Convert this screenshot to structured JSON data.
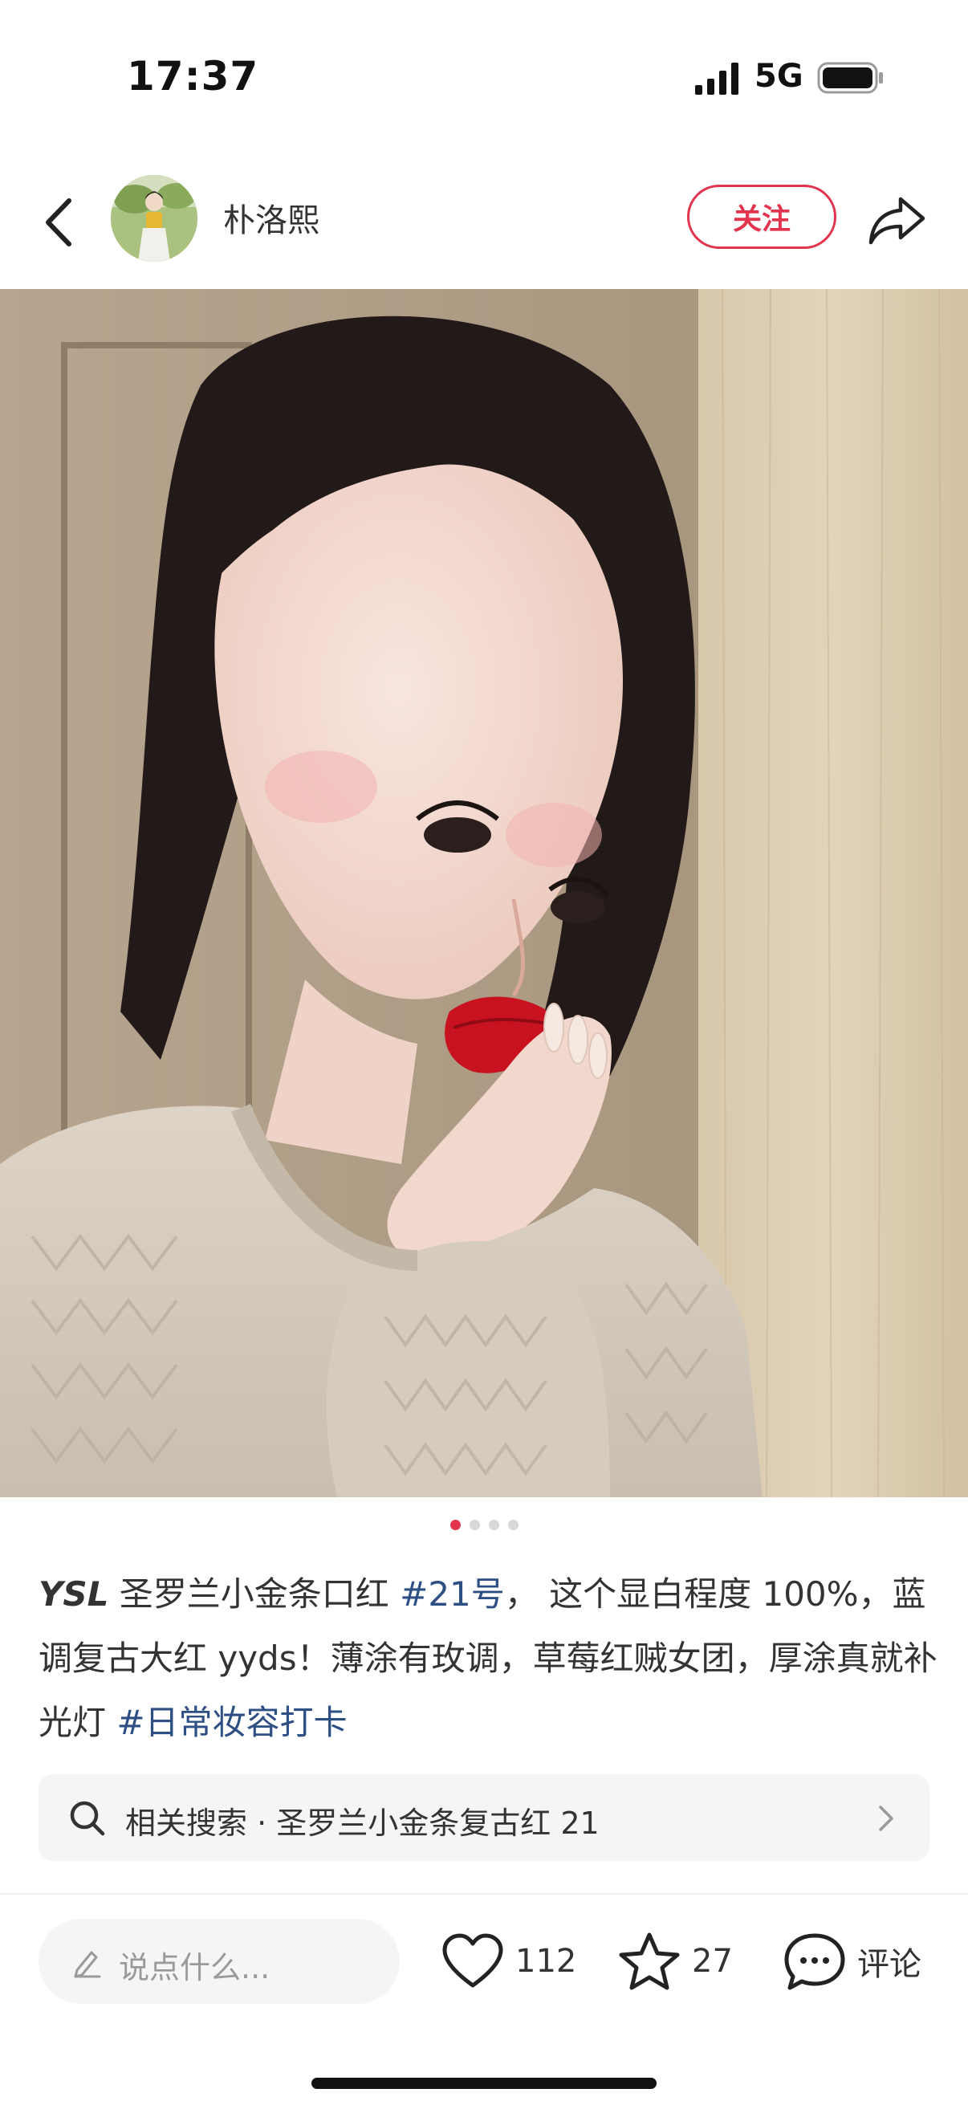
{
  "status_bar": {
    "time": "17:37",
    "network": "5G",
    "signal_icon": "signal-bars-icon",
    "battery_icon": "battery-icon"
  },
  "header": {
    "back_icon": "chevron-left-icon",
    "author_name": "朴洛熙",
    "follow_label": "关注",
    "share_icon": "share-icon",
    "accent_color": "#e3344e"
  },
  "photo": {
    "page_count": 4,
    "current_page": 1
  },
  "caption": {
    "brand": "YSL",
    "text_1": " 圣罗兰小金条口红 ",
    "hashtag_1": "#21号",
    "text_2": "， 这个显白程度 100%，蓝调复古大红 yyds！薄涂有玫调，草莓红贼女团，厚涂真就补光灯 ",
    "hashtag_2": "#日常妆容打卡",
    "hashtag_color": "#2d4f84"
  },
  "related_search": {
    "label": "相关搜索 · 圣罗兰小金条复古红 21"
  },
  "bottom_bar": {
    "comment_placeholder": "说点什么...",
    "likes": "112",
    "collects": "27",
    "comment_label": "评论"
  }
}
